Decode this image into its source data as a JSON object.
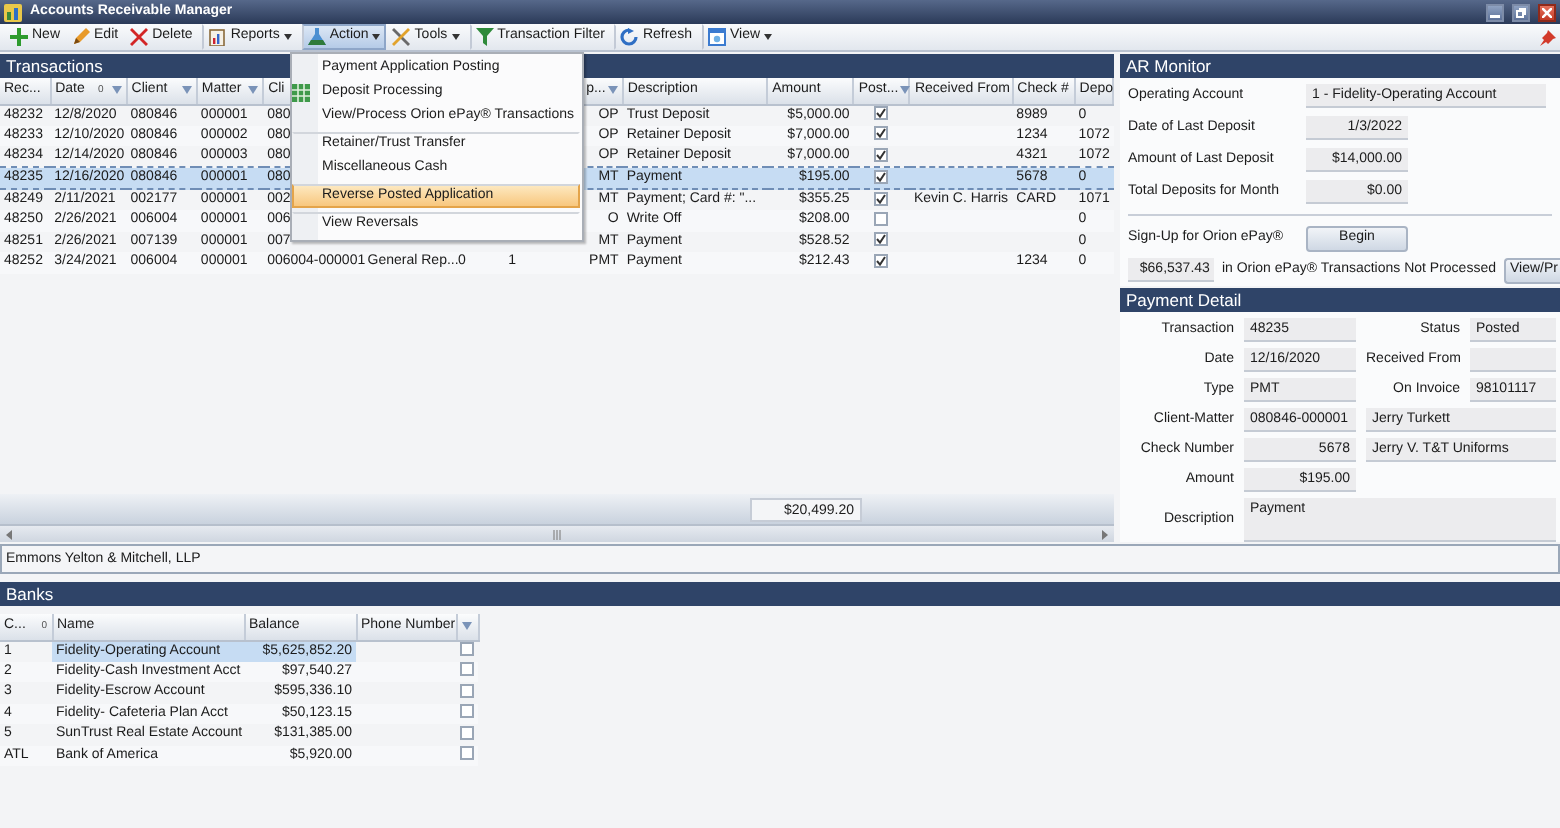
{
  "window": {
    "title": "Accounts Receivable Manager"
  },
  "toolbar": [
    {
      "kind": "new",
      "label": "New",
      "dropdown": false,
      "pressed": false,
      "separator_before": false
    },
    {
      "kind": "edit",
      "label": "Edit",
      "dropdown": false,
      "pressed": false,
      "separator_before": false
    },
    {
      "kind": "delete",
      "label": "Delete",
      "dropdown": false,
      "pressed": false,
      "separator_before": false
    },
    {
      "kind": "reports",
      "label": "Reports",
      "dropdown": true,
      "pressed": false,
      "separator_before": true
    },
    {
      "kind": "action",
      "label": "Action",
      "dropdown": true,
      "pressed": true,
      "separator_before": true
    },
    {
      "kind": "tools",
      "label": "Tools",
      "dropdown": true,
      "pressed": false,
      "separator_before": false
    },
    {
      "kind": "filter",
      "label": "Transaction Filter",
      "dropdown": false,
      "pressed": false,
      "separator_before": true
    },
    {
      "kind": "refresh",
      "label": "Refresh",
      "dropdown": false,
      "pressed": false,
      "separator_before": true
    },
    {
      "kind": "view",
      "label": "View",
      "dropdown": true,
      "pressed": false,
      "separator_before": true
    }
  ],
  "transactions": {
    "title": "Transactions",
    "columns": [
      {
        "label": "Rec...",
        "filter": false
      },
      {
        "label": "Date",
        "sort": "0",
        "filter": true
      },
      {
        "label": "Client",
        "filter": true
      },
      {
        "label": "Matter",
        "filter": true
      },
      {
        "label": "Cli"
      },
      null,
      null,
      null,
      {
        "label": "p...",
        "filter": true
      },
      {
        "label": "Description",
        "filter": false
      },
      {
        "label": "Amount",
        "filter": false
      },
      {
        "label": "Post...",
        "filter": true
      },
      {
        "label": "Received From"
      },
      {
        "label": "Check #"
      },
      {
        "label": "Depo"
      }
    ],
    "rows": [
      {
        "cells": [
          "48232",
          "12/8/2020",
          "080846",
          "000001",
          "080",
          null,
          null,
          null,
          "OP",
          "Trust Deposit",
          "$5,000.00",
          null,
          null,
          "8989",
          "0"
        ],
        "posted": true,
        "selected": false
      },
      {
        "cells": [
          "48233",
          "12/10/2020",
          "080846",
          "000002",
          "080",
          null,
          null,
          null,
          "OP",
          "Retainer Deposit",
          "$7,000.00",
          null,
          null,
          "1234",
          "1072"
        ],
        "posted": true,
        "selected": false
      },
      {
        "cells": [
          "48234",
          "12/14/2020",
          "080846",
          "000003",
          "080",
          null,
          null,
          null,
          "OP",
          "Retainer Deposit",
          "$7,000.00",
          null,
          null,
          "4321",
          "1072"
        ],
        "posted": true,
        "selected": false
      },
      {
        "cells": [
          "48235",
          "12/16/2020",
          "080846",
          "000001",
          "080",
          null,
          null,
          null,
          "MT",
          "Payment",
          "$195.00",
          null,
          null,
          "5678",
          "0"
        ],
        "posted": true,
        "selected": true
      },
      {
        "cells": [
          "48249",
          "2/11/2021",
          "002177",
          "000001",
          "002",
          null,
          null,
          null,
          "MT",
          "Payment; Card #: \"...",
          "$355.25",
          null,
          "Kevin C. Harris",
          "CARD",
          "1071"
        ],
        "posted": true,
        "selected": false
      },
      {
        "cells": [
          "48250",
          "2/26/2021",
          "006004",
          "000001",
          "006",
          null,
          null,
          null,
          "O",
          "Write Off",
          "$208.00",
          null,
          null,
          null,
          "0"
        ],
        "posted": false,
        "selected": false
      },
      {
        "cells": [
          "48251",
          "2/26/2021",
          "007139",
          "000001",
          "007",
          null,
          null,
          null,
          "MT",
          "Payment",
          "$528.52",
          null,
          null,
          null,
          "0"
        ],
        "posted": true,
        "selected": false
      },
      {
        "cells": [
          "48252",
          "3/24/2021",
          "006004",
          "000001",
          "006004-000001",
          "General Rep...",
          "0",
          "1",
          "PMT",
          "Payment",
          "$212.43",
          null,
          null,
          "1234",
          "0"
        ],
        "posted": true,
        "selected": false
      }
    ],
    "total": "$20,499.20"
  },
  "action_menu": [
    {
      "label": "Payment Application Posting",
      "has_icon": false,
      "separator_before": false,
      "selected": false
    },
    {
      "label": "Deposit Processing",
      "has_icon": true,
      "separator_before": false,
      "selected": false
    },
    {
      "label": "View/Process Orion ePay® Transactions",
      "has_icon": false,
      "separator_before": false,
      "selected": false
    },
    {
      "label": "Retainer/Trust Transfer",
      "has_icon": false,
      "separator_before": true,
      "selected": false
    },
    {
      "label": "Miscellaneous Cash",
      "has_icon": false,
      "separator_before": false,
      "selected": false
    },
    {
      "label": "Reverse Posted Application",
      "has_icon": false,
      "separator_before": true,
      "selected": true
    },
    {
      "label": "View Reversals",
      "has_icon": false,
      "separator_before": true,
      "selected": false
    }
  ],
  "firm_name": "Emmons Yelton & Mitchell, LLP",
  "ar_monitor": {
    "title": "AR Monitor",
    "fields": [
      {
        "label": "Operating Account",
        "value": "1 - Fidelity-Operating Account",
        "kind": "wide"
      },
      {
        "label": "Date of Last Deposit",
        "value": "1/3/2022",
        "kind": "short"
      },
      {
        "label": "Amount of Last Deposit",
        "value": "$14,000.00",
        "kind": "short"
      },
      {
        "label": "Total Deposits for Month",
        "value": "$0.00",
        "kind": "short"
      }
    ],
    "signup": {
      "label": "Sign-Up for Orion ePay®",
      "button": "Begin"
    },
    "pending": {
      "amount": "$66,537.43",
      "text": "in Orion ePay® Transactions Not Processed",
      "button": "View/Pr"
    }
  },
  "payment_detail": {
    "title": "Payment Detail",
    "rows": [
      {
        "kind": "pair",
        "label": "Transaction",
        "value": "48235",
        "numeric": false,
        "label2": "Status",
        "value2": "Posted"
      },
      {
        "kind": "pair",
        "label": "Date",
        "value": "12/16/2020",
        "numeric": false,
        "label2": "Received From"
      },
      {
        "kind": "pair",
        "label": "Type",
        "value": "PMT",
        "numeric": false,
        "label2": "On Invoice",
        "value2": "98101117"
      },
      {
        "kind": "wide",
        "label": "Client-Matter",
        "value": "080846-000001",
        "numeric": false,
        "value2": "Jerry Turkett"
      },
      {
        "kind": "wide",
        "label": "Check Number",
        "value": "5678",
        "numeric": true,
        "value2": "Jerry V. T&T Uniforms"
      },
      {
        "kind": "single",
        "label": "Amount",
        "value": "$195.00",
        "numeric": true
      },
      {
        "kind": "memo",
        "label": "Description",
        "value": "Payment",
        "numeric": false
      }
    ]
  },
  "banks": {
    "title": "Banks",
    "columns": [
      {
        "label": "C...",
        "sort": "0"
      },
      {
        "label": "Name"
      },
      {
        "label": "Balance"
      },
      {
        "label": "Phone Number"
      }
    ],
    "rows": [
      {
        "code": "1",
        "name": "Fidelity-Operating Account",
        "balance": "$5,625,852.20",
        "checked": false,
        "selected": true
      },
      {
        "code": "2",
        "name": "Fidelity-Cash Investment Acct",
        "balance": "$97,540.27",
        "checked": false,
        "selected": false
      },
      {
        "code": "3",
        "name": "Fidelity-Escrow Account",
        "balance": "$595,336.10",
        "checked": false,
        "selected": false
      },
      {
        "code": "4",
        "name": "Fidelity- Cafeteria Plan Acct",
        "balance": "$50,123.15",
        "checked": false,
        "selected": false
      },
      {
        "code": "5",
        "name": "SunTrust Real Estate Account",
        "balance": "$131,385.00",
        "checked": false,
        "selected": false
      },
      {
        "code": "ATL",
        "name": "Bank of America",
        "balance": "$5,920.00",
        "checked": false,
        "selected": false
      }
    ]
  }
}
